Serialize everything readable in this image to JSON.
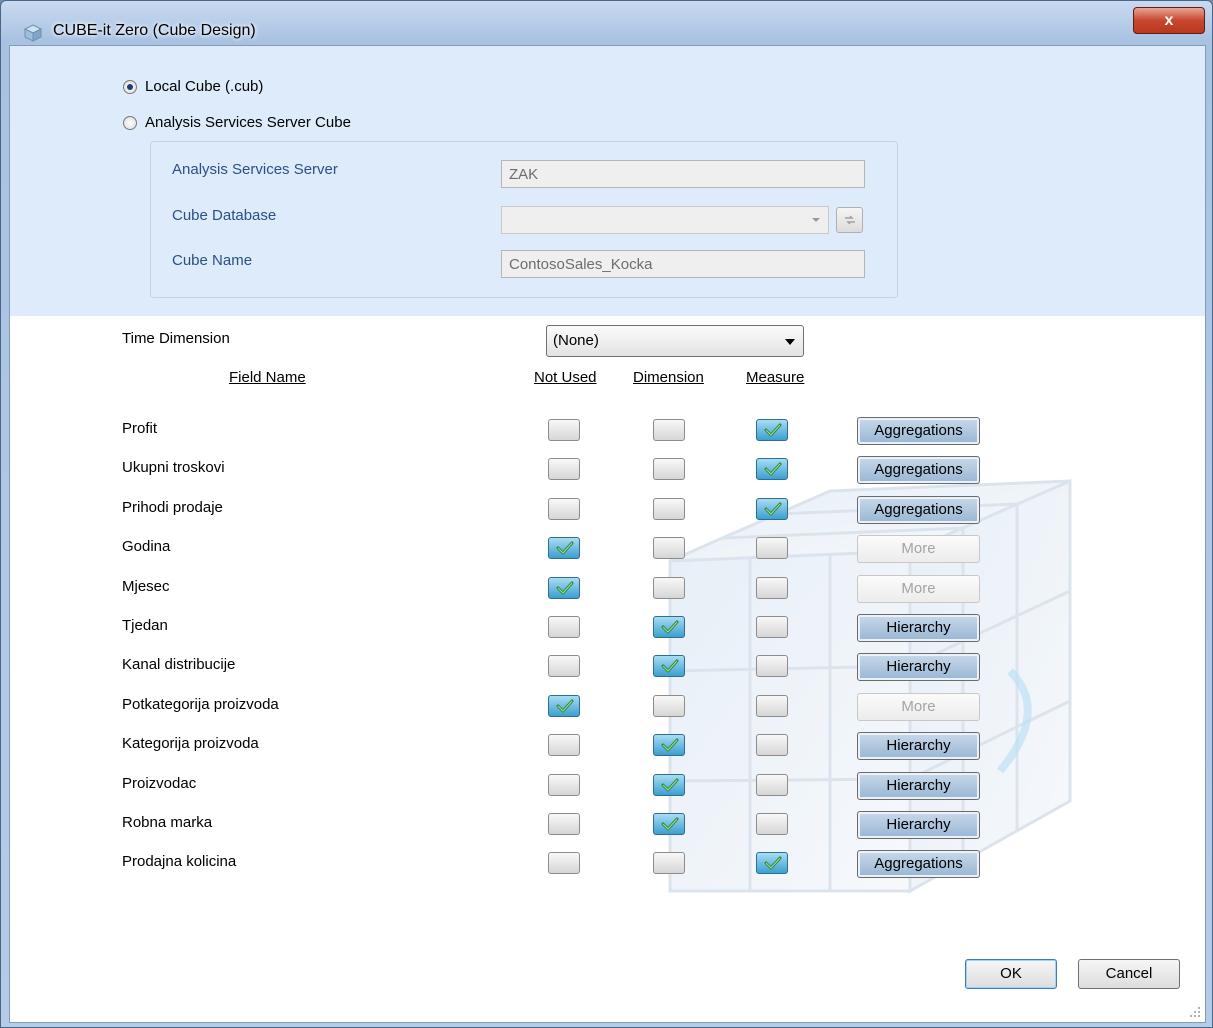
{
  "window": {
    "title": "CUBE-it Zero (Cube Design)",
    "close_label": "x"
  },
  "cube_source": {
    "local_label": "Local Cube (.cub)",
    "server_label": "Analysis Services Server Cube",
    "selected": "local"
  },
  "server_fields": {
    "server_label": "Analysis Services Server",
    "server_value": "ZAK",
    "database_label": "Cube Database",
    "database_value": "",
    "cube_name_label": "Cube Name",
    "cube_name_value": "ContosoSales_Kocka"
  },
  "time_dimension": {
    "label": "Time Dimension",
    "value": "(None)"
  },
  "columns": {
    "field_name": "Field Name",
    "not_used": "Not Used",
    "dimension": "Dimension",
    "measure": "Measure"
  },
  "rows": [
    {
      "name": "Profit",
      "state": "measure",
      "action": "Aggregations",
      "action_enabled": true
    },
    {
      "name": "Ukupni troskovi",
      "state": "measure",
      "action": "Aggregations",
      "action_enabled": true
    },
    {
      "name": "Prihodi prodaje",
      "state": "measure",
      "action": "Aggregations",
      "action_enabled": true
    },
    {
      "name": "Godina",
      "state": "not_used",
      "action": "More",
      "action_enabled": false
    },
    {
      "name": "Mjesec",
      "state": "not_used",
      "action": "More",
      "action_enabled": false
    },
    {
      "name": "Tjedan",
      "state": "dimension",
      "action": "Hierarchy",
      "action_enabled": true
    },
    {
      "name": "Kanal distribucije",
      "state": "dimension",
      "action": "Hierarchy",
      "action_enabled": true
    },
    {
      "name": "Potkategorija proizvoda",
      "state": "not_used",
      "action": "More",
      "action_enabled": false
    },
    {
      "name": "Kategorija proizvoda",
      "state": "dimension",
      "action": "Hierarchy",
      "action_enabled": true
    },
    {
      "name": "Proizvodac",
      "state": "dimension",
      "action": "Hierarchy",
      "action_enabled": true
    },
    {
      "name": "Robna marka",
      "state": "dimension",
      "action": "Hierarchy",
      "action_enabled": true
    },
    {
      "name": "Prodajna kolicina",
      "state": "measure",
      "action": "Aggregations",
      "action_enabled": true
    }
  ],
  "buttons": {
    "ok": "OK",
    "cancel": "Cancel"
  },
  "colors": {
    "accent": "#2c4f86",
    "check_on": "#3c9fd0",
    "panel": "#ddebfa"
  }
}
